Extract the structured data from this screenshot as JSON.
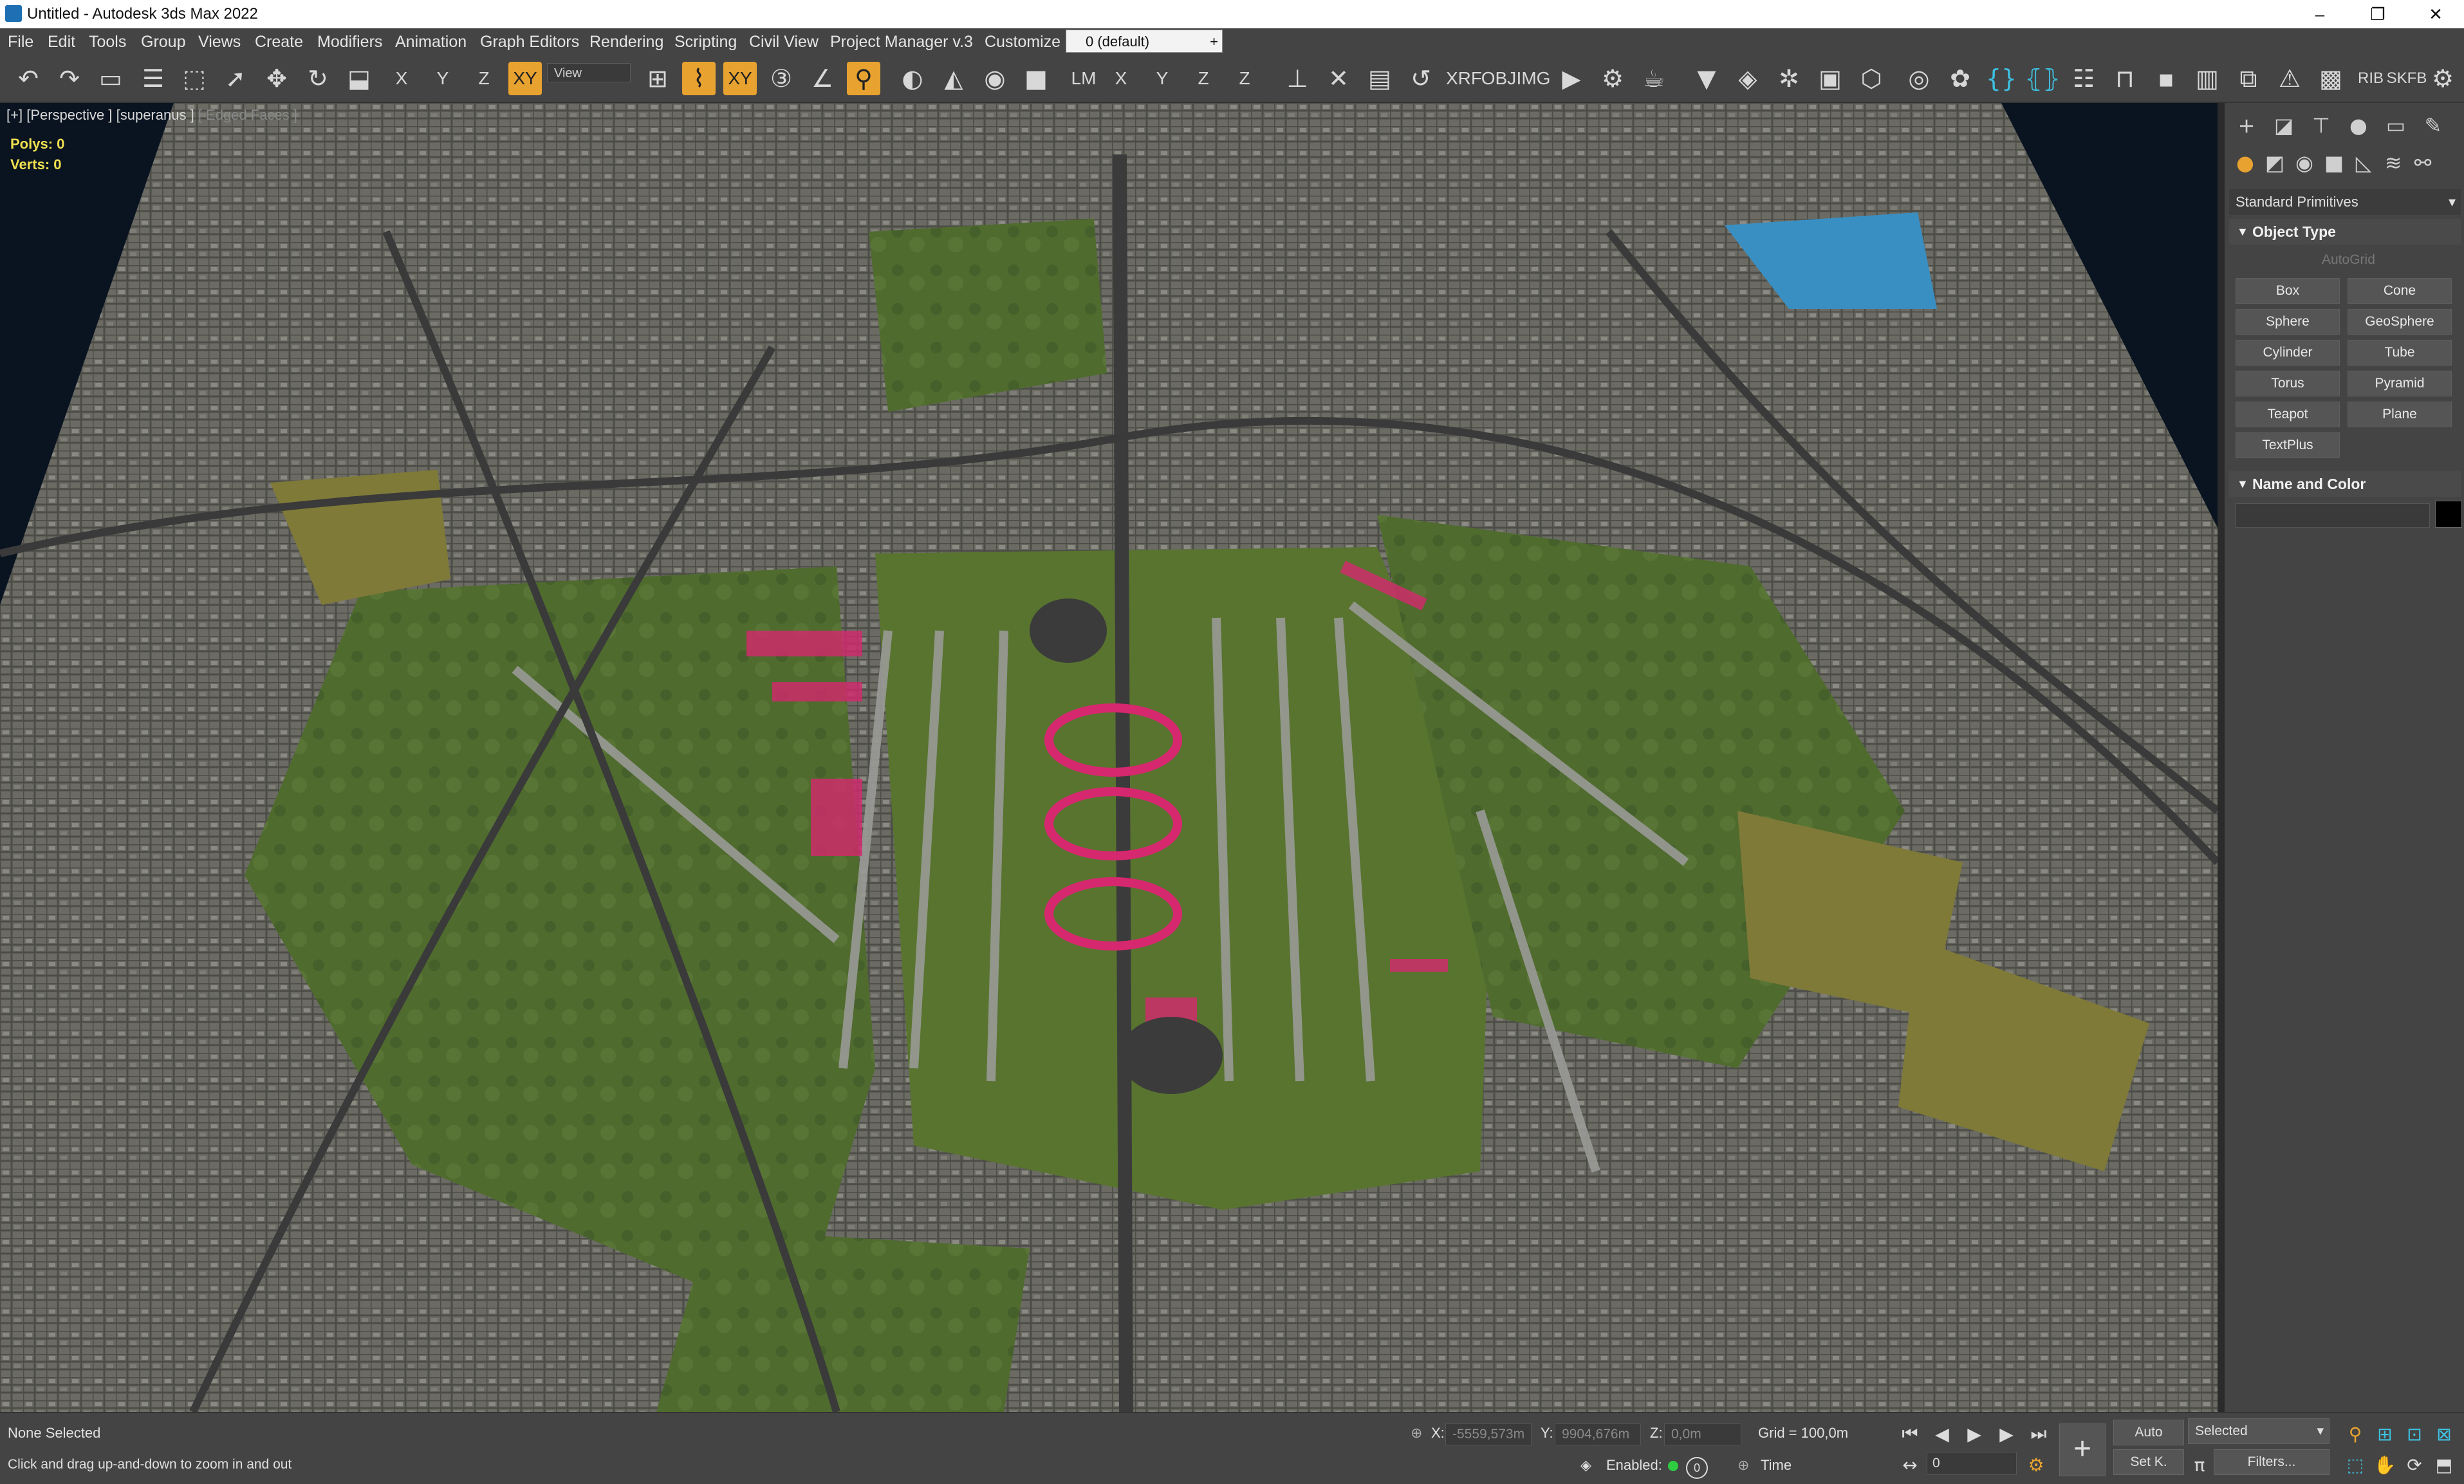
{
  "window": {
    "title": "Untitled - Autodesk 3ds Max 2022",
    "controls": [
      "–",
      "❐",
      "✕"
    ]
  },
  "menu": {
    "items": [
      "File",
      "Edit",
      "Tools",
      "Group",
      "Views",
      "Create",
      "Modifiers",
      "Animation",
      "Graph Editors",
      "Rendering",
      "Scripting",
      "Civil View",
      "Project Manager v.3",
      "Customize"
    ],
    "layer_dropdown": "0 (default)"
  },
  "toolbar": {
    "view_dropdown": "View",
    "text_buttons": [
      "X",
      "Y",
      "Z",
      "XY",
      "XY",
      "LM",
      "X",
      "Y",
      "Z",
      "Z",
      "XRF",
      "OBJ",
      "IMG",
      "RIB",
      "SKFB"
    ]
  },
  "viewport": {
    "label_plus": "[+]",
    "label_view": "[Perspective ]",
    "label_shading": "[superanus ]",
    "label_edges": "[ Edged Faces ]",
    "polys_label": "Polys:",
    "polys_value": "0",
    "verts_label": "Verts:",
    "verts_value": "0"
  },
  "command_panel": {
    "category": "Standard Primitives",
    "object_type_title": "Object Type",
    "autogrid": "AutoGrid",
    "primitives": [
      "Box",
      "Cone",
      "Sphere",
      "GeoSphere",
      "Cylinder",
      "Tube",
      "Torus",
      "Pyramid",
      "Teapot",
      "Plane",
      "TextPlus"
    ],
    "name_color_title": "Name and Color",
    "swatch_color": "#000000"
  },
  "status": {
    "selection": "None Selected",
    "prompt": "Click and drag up-and-down to zoom in and out",
    "x_label": "X:",
    "x_value": "-5559,573m",
    "y_label": "Y:",
    "y_value": "9904,676m",
    "z_label": "Z:",
    "z_value": "0,0m",
    "grid": "Grid = 100,0m",
    "enabled_label": "Enabled:",
    "time_label": "Time",
    "auto_button": "Auto",
    "selected_dropdown": "Selected",
    "setkey_button": "Set K.",
    "filters_button": "Filters...",
    "frame_value": "0"
  },
  "colors": {
    "accent": "#e8a230",
    "ui_bg": "#444444",
    "viewport_bg": "#0a1420",
    "terrain_green": "#4f6b2e",
    "terrain_urban": "#6b6b64",
    "highlight_pink": "#d6286e"
  }
}
